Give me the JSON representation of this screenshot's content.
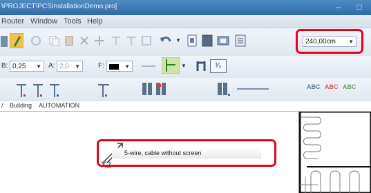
{
  "window": {
    "title": "\\PROJECT\\PCSInstallationDemo.pro]",
    "minimize": "–",
    "maximize": "□"
  },
  "menu": {
    "items": [
      "Router",
      "Window",
      "Tools",
      "Help"
    ]
  },
  "toolbar": {
    "zoom_value": "240,00cm",
    "line_width_label": "B:",
    "line_width_value": "0,25",
    "text_height_label": "A:",
    "text_height_value": "2,0",
    "color_label": "F:",
    "symbol_label": "¹⁄₂",
    "text_styles": [
      "ABC",
      "ABC",
      "ABC"
    ]
  },
  "tabs": {
    "building": "Building",
    "automation": "AUTOMATION"
  },
  "canvas": {
    "cable_label": "5-wire, cable without screen",
    "tag": "-X2"
  },
  "colors": {
    "highlight": "#e8001c",
    "titlebar": "#3b78b5",
    "toolbar": "#e6edf5"
  }
}
